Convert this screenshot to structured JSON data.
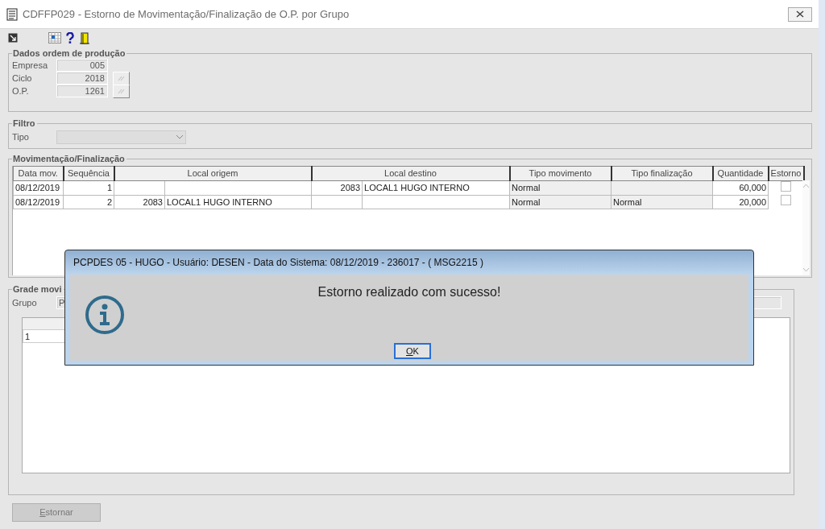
{
  "window": {
    "title": "CDFFP029 - Estorno de Movimentação/Finalização de O.P. por Grupo"
  },
  "dados": {
    "legend": "Dados ordem de produção",
    "fields": [
      {
        "label": "Empresa",
        "value": "005",
        "lookup": false
      },
      {
        "label": "Ciclo",
        "value": "2018",
        "lookup": true
      },
      {
        "label": "O.P.",
        "value": "1261",
        "lookup": true
      }
    ]
  },
  "filtro": {
    "legend": "Filtro",
    "label": "Tipo"
  },
  "movimentacao": {
    "legend": "Movimentação/Finalização",
    "columns": [
      "Data mov.",
      "Sequência",
      "Local origem",
      "Local destino",
      "Tipo movimento",
      "Tipo finalização",
      "Quantidade",
      "Estorno"
    ],
    "rows": [
      {
        "data": "08/12/2019",
        "sequencia": "1",
        "destino_codigo": "2083",
        "destino_nome": "LOCAL1 HUGO INTERNO",
        "tipo_movimento": "Normal",
        "quantidade": "60,000",
        "estorno": false
      },
      {
        "data": "08/12/2019",
        "sequencia": "2",
        "origem_codigo": "2083",
        "origem_nome": "LOCAL1 HUGO INTERNO",
        "tipo_movimento": "Normal",
        "tipo_finalizacao": "Normal",
        "quantidade": "20,000",
        "estorno": false
      }
    ]
  },
  "grade": {
    "legend": "Grade movi",
    "label": "Grupo",
    "value": "P",
    "rows": [
      "1"
    ]
  },
  "dialog": {
    "title": "PCPDES 05 - HUGO - Usuário: DESEN - Data do Sistema: 08/12/2019 - 236017 - ( MSG2215 )",
    "message": "Estorno realizado com sucesso!",
    "button": "OK"
  },
  "footer": {
    "button": "Estornar",
    "disabled": true
  }
}
